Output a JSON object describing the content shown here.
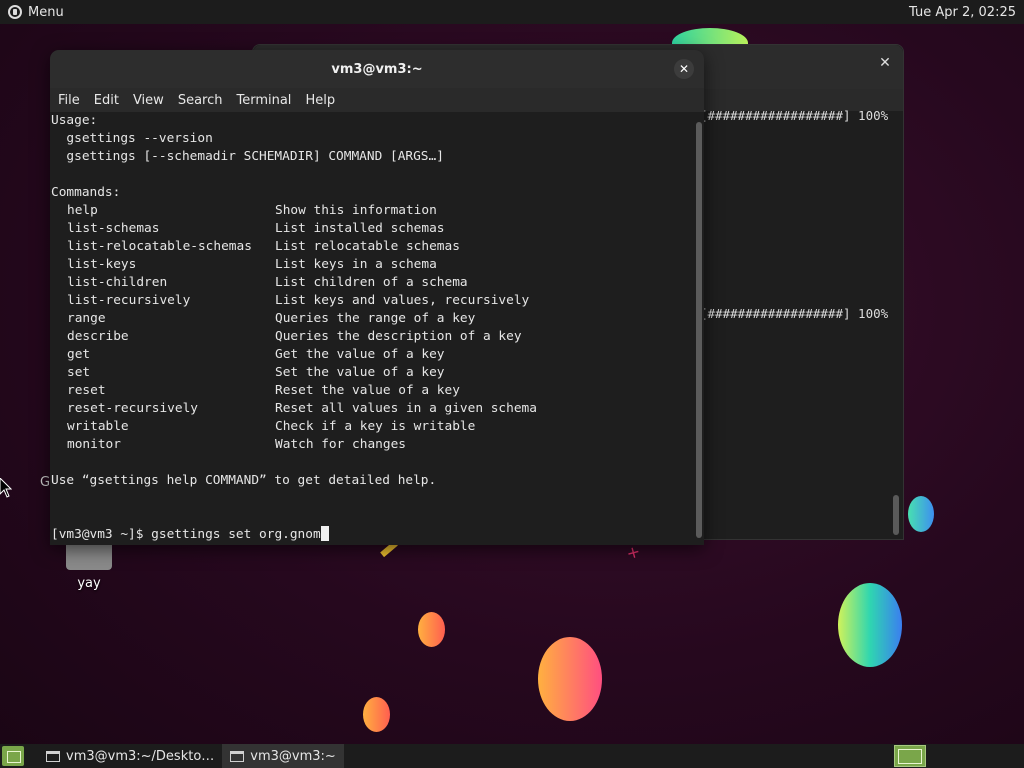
{
  "top_panel": {
    "menu_label": "Menu",
    "clock": "Tue Apr 2, 02:25"
  },
  "desktop": {
    "icon_label": "yay",
    "stray_char": "G"
  },
  "back_window": {
    "progress_line_1": "[##################] 100%",
    "progress_line_2": "[##################] 100%",
    "close_glyph": "✕"
  },
  "front_window": {
    "title": "vm3@vm3:~",
    "close_glyph": "✕",
    "menu": [
      "File",
      "Edit",
      "View",
      "Search",
      "Terminal",
      "Help"
    ]
  },
  "terminal": {
    "usage_header": "Usage:",
    "usage_1": "  gsettings --version",
    "usage_2": "  gsettings [--schemadir SCHEMADIR] COMMAND [ARGS…]",
    "commands_header": "Commands:",
    "commands": [
      {
        "cmd": "help",
        "desc": "Show this information"
      },
      {
        "cmd": "list-schemas",
        "desc": "List installed schemas"
      },
      {
        "cmd": "list-relocatable-schemas",
        "desc": "List relocatable schemas"
      },
      {
        "cmd": "list-keys",
        "desc": "List keys in a schema"
      },
      {
        "cmd": "list-children",
        "desc": "List children of a schema"
      },
      {
        "cmd": "list-recursively",
        "desc": "List keys and values, recursively"
      },
      {
        "cmd": "range",
        "desc": "Queries the range of a key"
      },
      {
        "cmd": "describe",
        "desc": "Queries the description of a key"
      },
      {
        "cmd": "get",
        "desc": "Get the value of a key"
      },
      {
        "cmd": "set",
        "desc": "Set the value of a key"
      },
      {
        "cmd": "reset",
        "desc": "Reset the value of a key"
      },
      {
        "cmd": "reset-recursively",
        "desc": "Reset all values in a given schema"
      },
      {
        "cmd": "writable",
        "desc": "Check if a key is writable"
      },
      {
        "cmd": "monitor",
        "desc": "Watch for changes"
      }
    ],
    "help_hint": "Use “gsettings help COMMAND” to get detailed help.",
    "prompt": "[vm3@vm3 ~]$ ",
    "current_input": "gsettings set org.gnom"
  },
  "taskbar": {
    "tasks": [
      {
        "label": "vm3@vm3:~/Deskto…"
      },
      {
        "label": "vm3@vm3:~"
      }
    ]
  }
}
